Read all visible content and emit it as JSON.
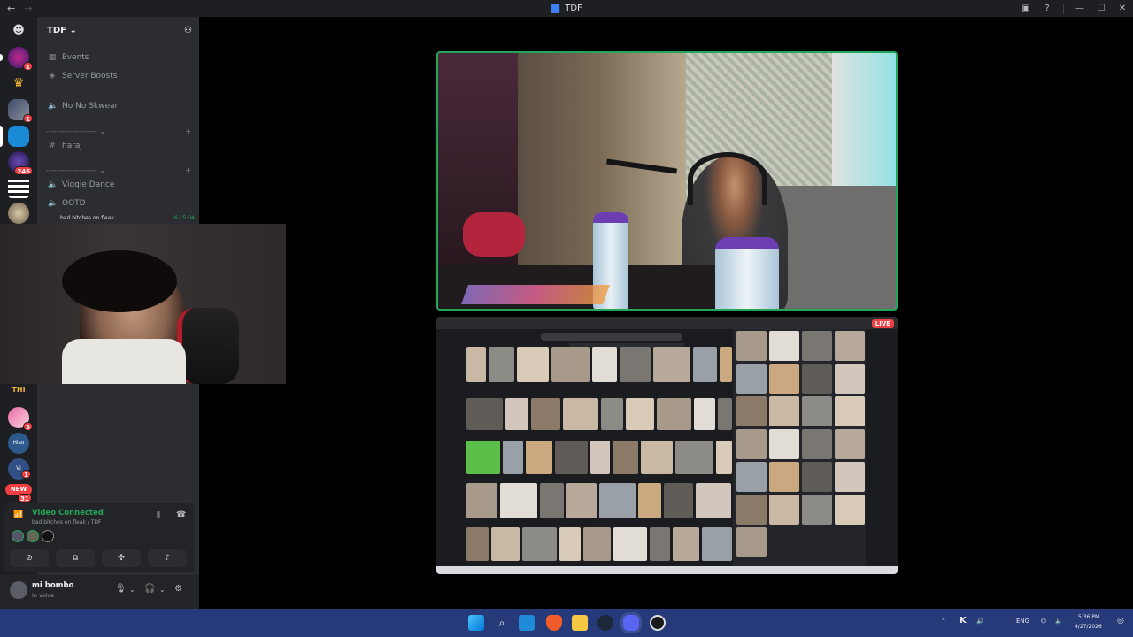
{
  "window": {
    "title": "TDF",
    "back_icon": "arrow-left-icon",
    "forward_icon": "arrow-right-icon"
  },
  "servers": {
    "badges": [
      "1",
      "1",
      "246",
      "3",
      "1",
      "31"
    ],
    "new_label": "NEW"
  },
  "guild": {
    "name": "TDF",
    "channels": {
      "events": "Events",
      "server_boosts": "Server Boosts",
      "no_no_skwear": "No No Skwear",
      "category_1": "-------------------- ⌄",
      "haraj": "haraj",
      "category_2": "-------------------- ⌄",
      "viggle_dance": "Viggle Dance",
      "ootd": "OOTD",
      "active_voice": "bad bitches on fleak",
      "active_voice_timer": "6:15:04"
    }
  },
  "voice_panel": {
    "status": "Video Connected",
    "channel_path": "bad bitches on fleak / TDF"
  },
  "user": {
    "name": "mi bombo",
    "status": "In voice"
  },
  "stream": {
    "live_label": "LIVE"
  },
  "taskbar": {
    "language": "ENG",
    "time": "5:36 PM",
    "date": "4/27/2026"
  },
  "colors": {
    "accent_green": "#23a55a",
    "danger_red": "#f23f43",
    "sidebar_bg": "#2b2d31",
    "server_bg": "#1e1f22",
    "taskbar_bg": "#263a7a"
  }
}
